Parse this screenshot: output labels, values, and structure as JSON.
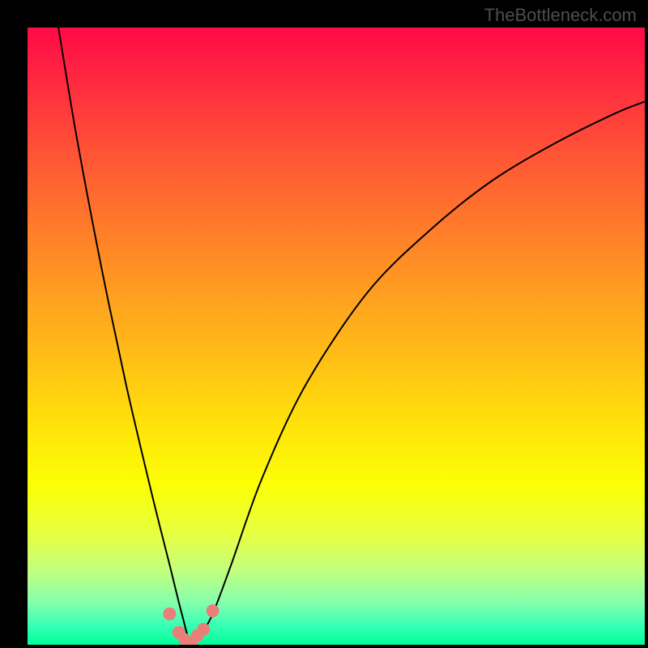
{
  "watermark": "TheBottleneck.com",
  "colors": {
    "background_outer": "#000000",
    "gradient_top": "#ff0a47",
    "gradient_bottom": "#00ff98",
    "curve": "#000000",
    "marker": "#e88079"
  },
  "chart_data": {
    "type": "line",
    "title": "",
    "xlabel": "",
    "ylabel": "",
    "xlim": [
      0,
      100
    ],
    "ylim": [
      0,
      100
    ],
    "grid": false,
    "legend": null,
    "series": [
      {
        "name": "bottleneck-curve",
        "x": [
          5,
          8,
          12,
          16,
          20,
          23,
          25,
          26.5,
          28,
          30,
          33,
          38,
          45,
          55,
          65,
          75,
          85,
          95,
          100
        ],
        "y": [
          100,
          82,
          61,
          42,
          25,
          13,
          5,
          0,
          1.5,
          5,
          13,
          27,
          42,
          57,
          67,
          75,
          81,
          86,
          88
        ]
      }
    ],
    "markers": {
      "name": "bottom-cluster",
      "x": [
        23.0,
        24.5,
        25.5,
        26.5,
        27.5,
        28.5,
        30.0
      ],
      "y": [
        5.0,
        2.0,
        0.8,
        0.3,
        1.5,
        2.5,
        5.5
      ]
    },
    "notes": "V-shaped bottleneck curve over rainbow heat gradient; axis values are normalized 0-100 estimates read from pixel positions since no tick labels are shown."
  }
}
